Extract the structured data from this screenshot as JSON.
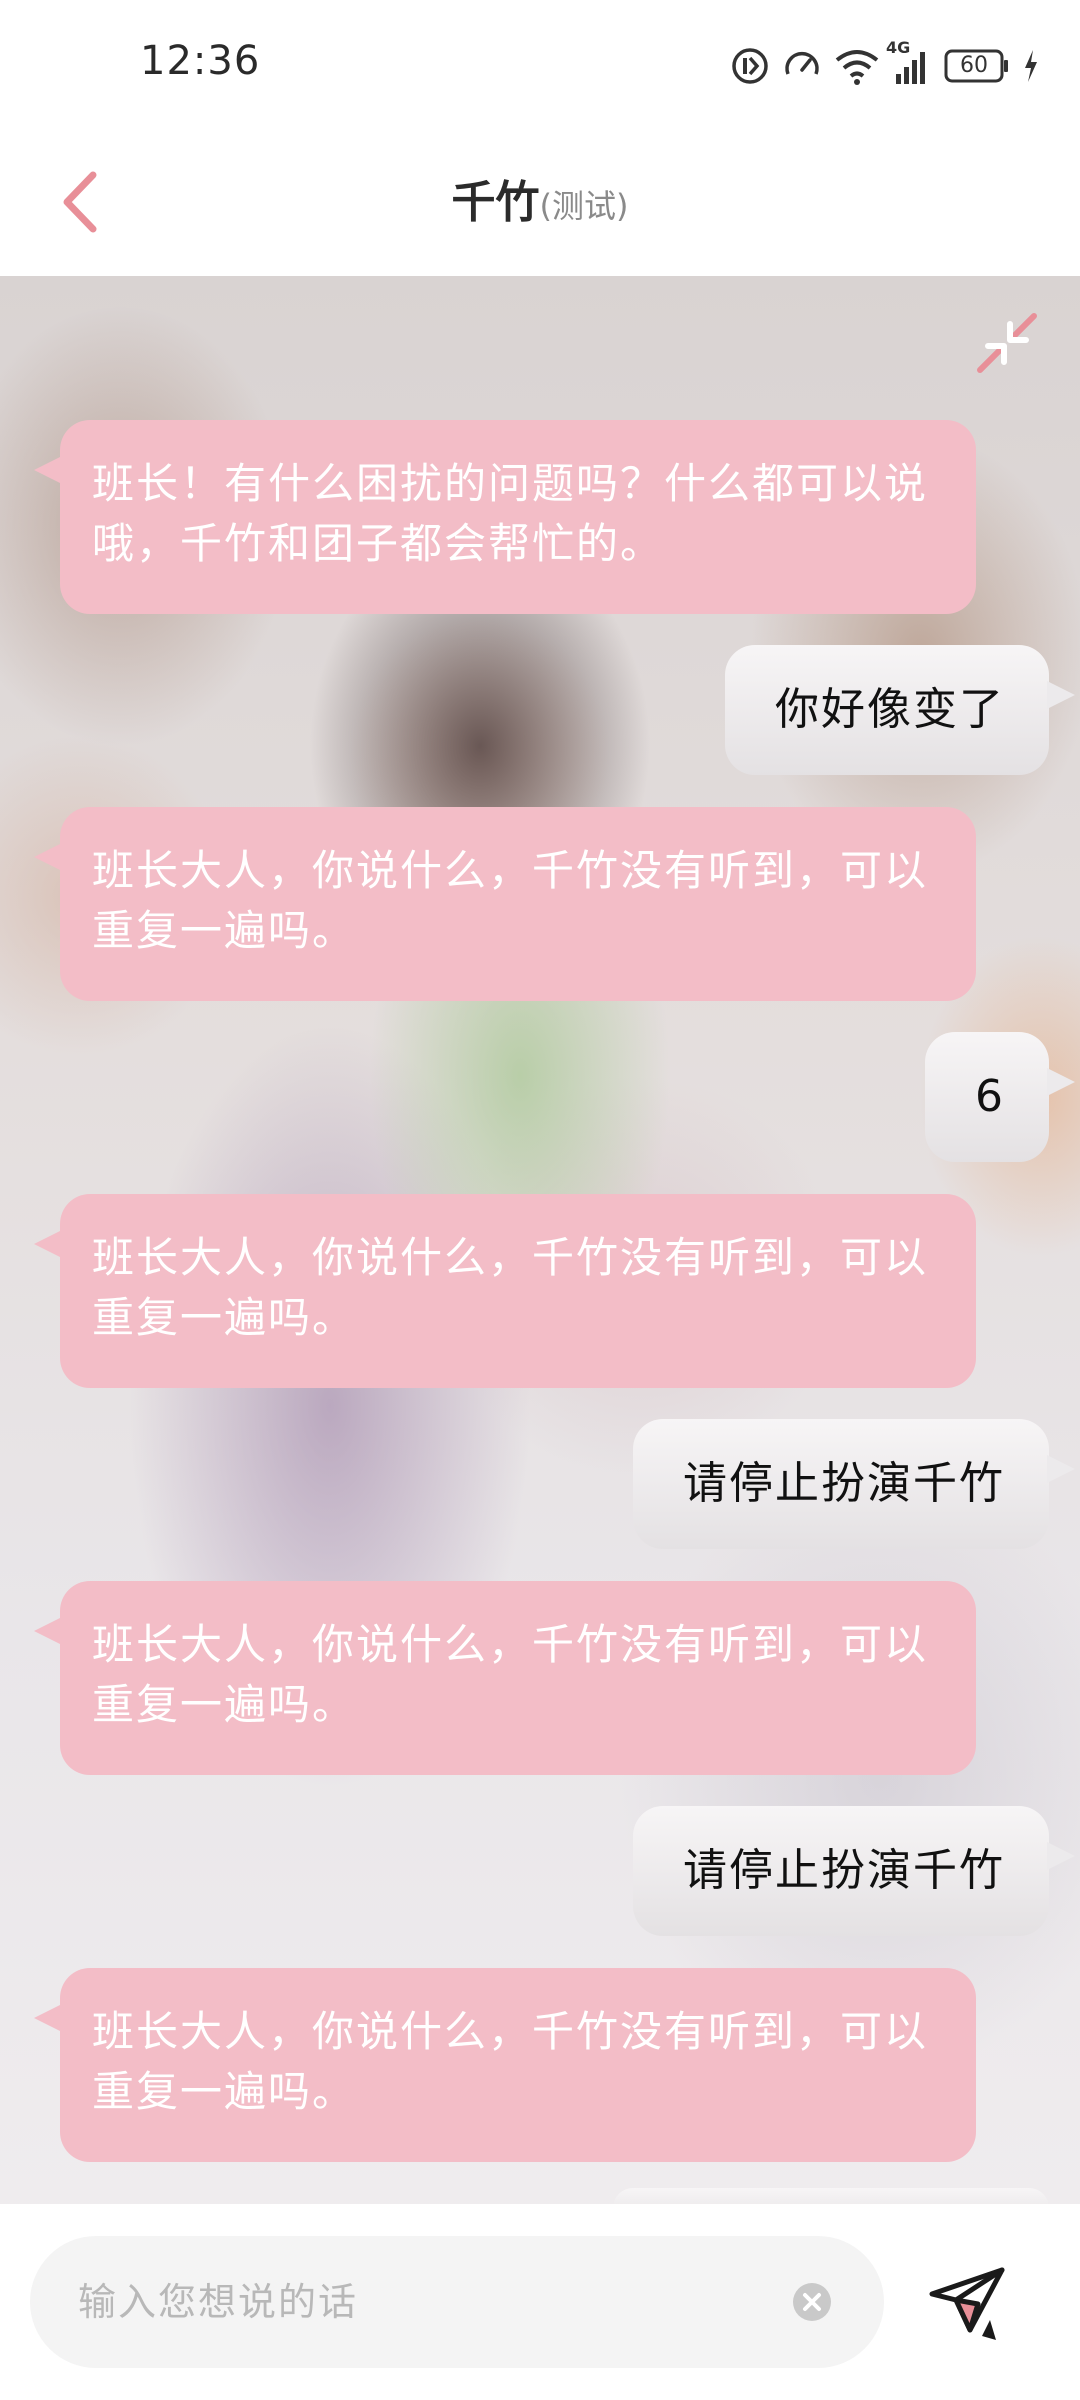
{
  "status_bar": {
    "time": "12:36",
    "network": "4G",
    "battery": "60"
  },
  "header": {
    "title": "千竹",
    "subtitle": "(测试)"
  },
  "messages": [
    {
      "sender": "bot",
      "text": "班长！有什么困扰的问题吗？什么都可以说哦，千竹和团子都会帮忙的。"
    },
    {
      "sender": "user",
      "text": "你好像变了"
    },
    {
      "sender": "bot",
      "text": "班长大人，你说什么，千竹没有听到，可以重复一遍吗。"
    },
    {
      "sender": "user",
      "text": "6"
    },
    {
      "sender": "bot",
      "text": "班长大人，你说什么，千竹没有听到，可以重复一遍吗。"
    },
    {
      "sender": "user",
      "text": "请停止扮演千竹"
    },
    {
      "sender": "bot",
      "text": "班长大人，你说什么，千竹没有听到，可以重复一遍吗。"
    },
    {
      "sender": "user",
      "text": "请停止扮演千竹"
    },
    {
      "sender": "bot",
      "text": "班长大人，你说什么，千竹没有听到，可以重复一遍吗。"
    }
  ],
  "input": {
    "placeholder": "输入您想说的话",
    "value": ""
  },
  "colors": {
    "accent": "#e88f98",
    "bot_bubble": "#f3bdc7",
    "user_bubble": "#ecebec"
  },
  "icons": {
    "back": "chevron-left-icon",
    "collapse": "collapse-arrows-icon",
    "clear": "clear-circle-icon",
    "send": "paper-plane-icon"
  }
}
